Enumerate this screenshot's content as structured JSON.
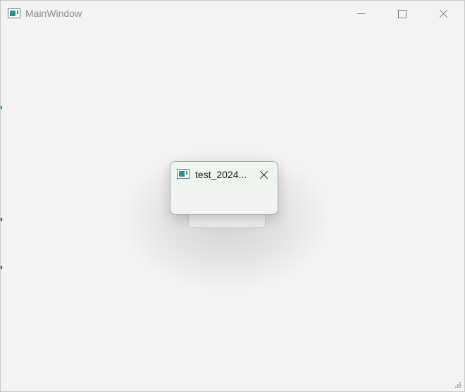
{
  "main_window": {
    "title": "MainWindow",
    "icon": "app-window-icon",
    "controls": {
      "minimize": "minimize-icon",
      "maximize": "maximize-icon",
      "close": "close-icon"
    }
  },
  "popup": {
    "title": "test_2024...",
    "icon": "app-window-icon",
    "close": "close-icon",
    "colors": {
      "titlebar": "#eef4ee",
      "body": "#f1f3f1"
    }
  },
  "colors": {
    "window_bg": "#f3f3f3",
    "icon_accent": "#2f8f8f"
  }
}
